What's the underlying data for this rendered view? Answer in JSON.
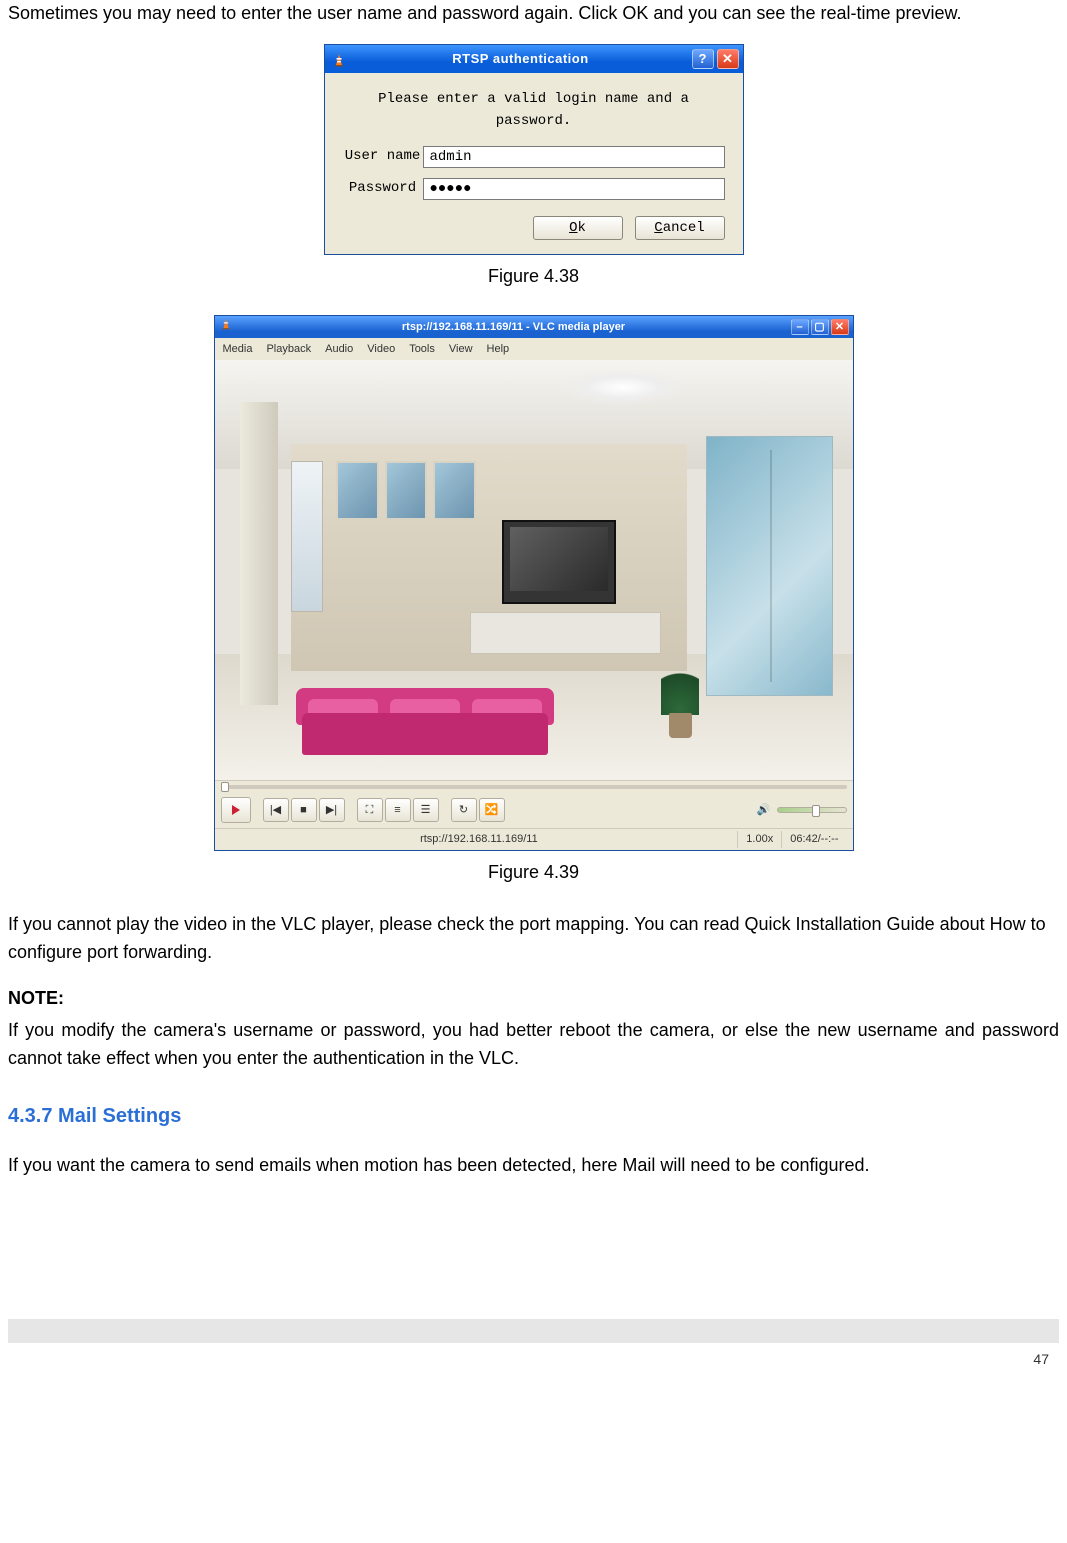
{
  "intro_text": "Sometimes you may need to enter the user name and password again. Click OK and you can see the real-time preview.",
  "dialog": {
    "title": "RTSP authentication",
    "prompt": "Please enter a valid login name and a password.",
    "username_label": "User name",
    "username_value": "admin",
    "password_label": "Password",
    "password_value": "●●●●●",
    "ok_label": "Ok",
    "cancel_label": "Cancel"
  },
  "figure1_caption": "Figure 4.38",
  "vlc": {
    "title": "rtsp://192.168.11.169/11 - VLC media player",
    "menu": [
      "Media",
      "Playback",
      "Audio",
      "Video",
      "Tools",
      "View",
      "Help"
    ],
    "status_left": "rtsp://192.168.11.169/11",
    "status_speed": "1.00x",
    "status_time": "06:42/--:--"
  },
  "figure2_caption": "Figure 4.39",
  "after_fig2_para": "If you cannot play the video in the VLC player, please check the port mapping. You can read Quick Installation Guide about How to configure port forwarding.",
  "note_label": "NOTE:",
  "note_text": "If you modify the camera's username or password, you had better reboot the camera, or else the new username and password cannot take effect when you enter the authentication in the VLC.",
  "section_heading": "4.3.7 Mail Settings",
  "mail_para": "If you want the camera to send emails when motion has been detected, here Mail will need to be configured.",
  "page_number": "47"
}
